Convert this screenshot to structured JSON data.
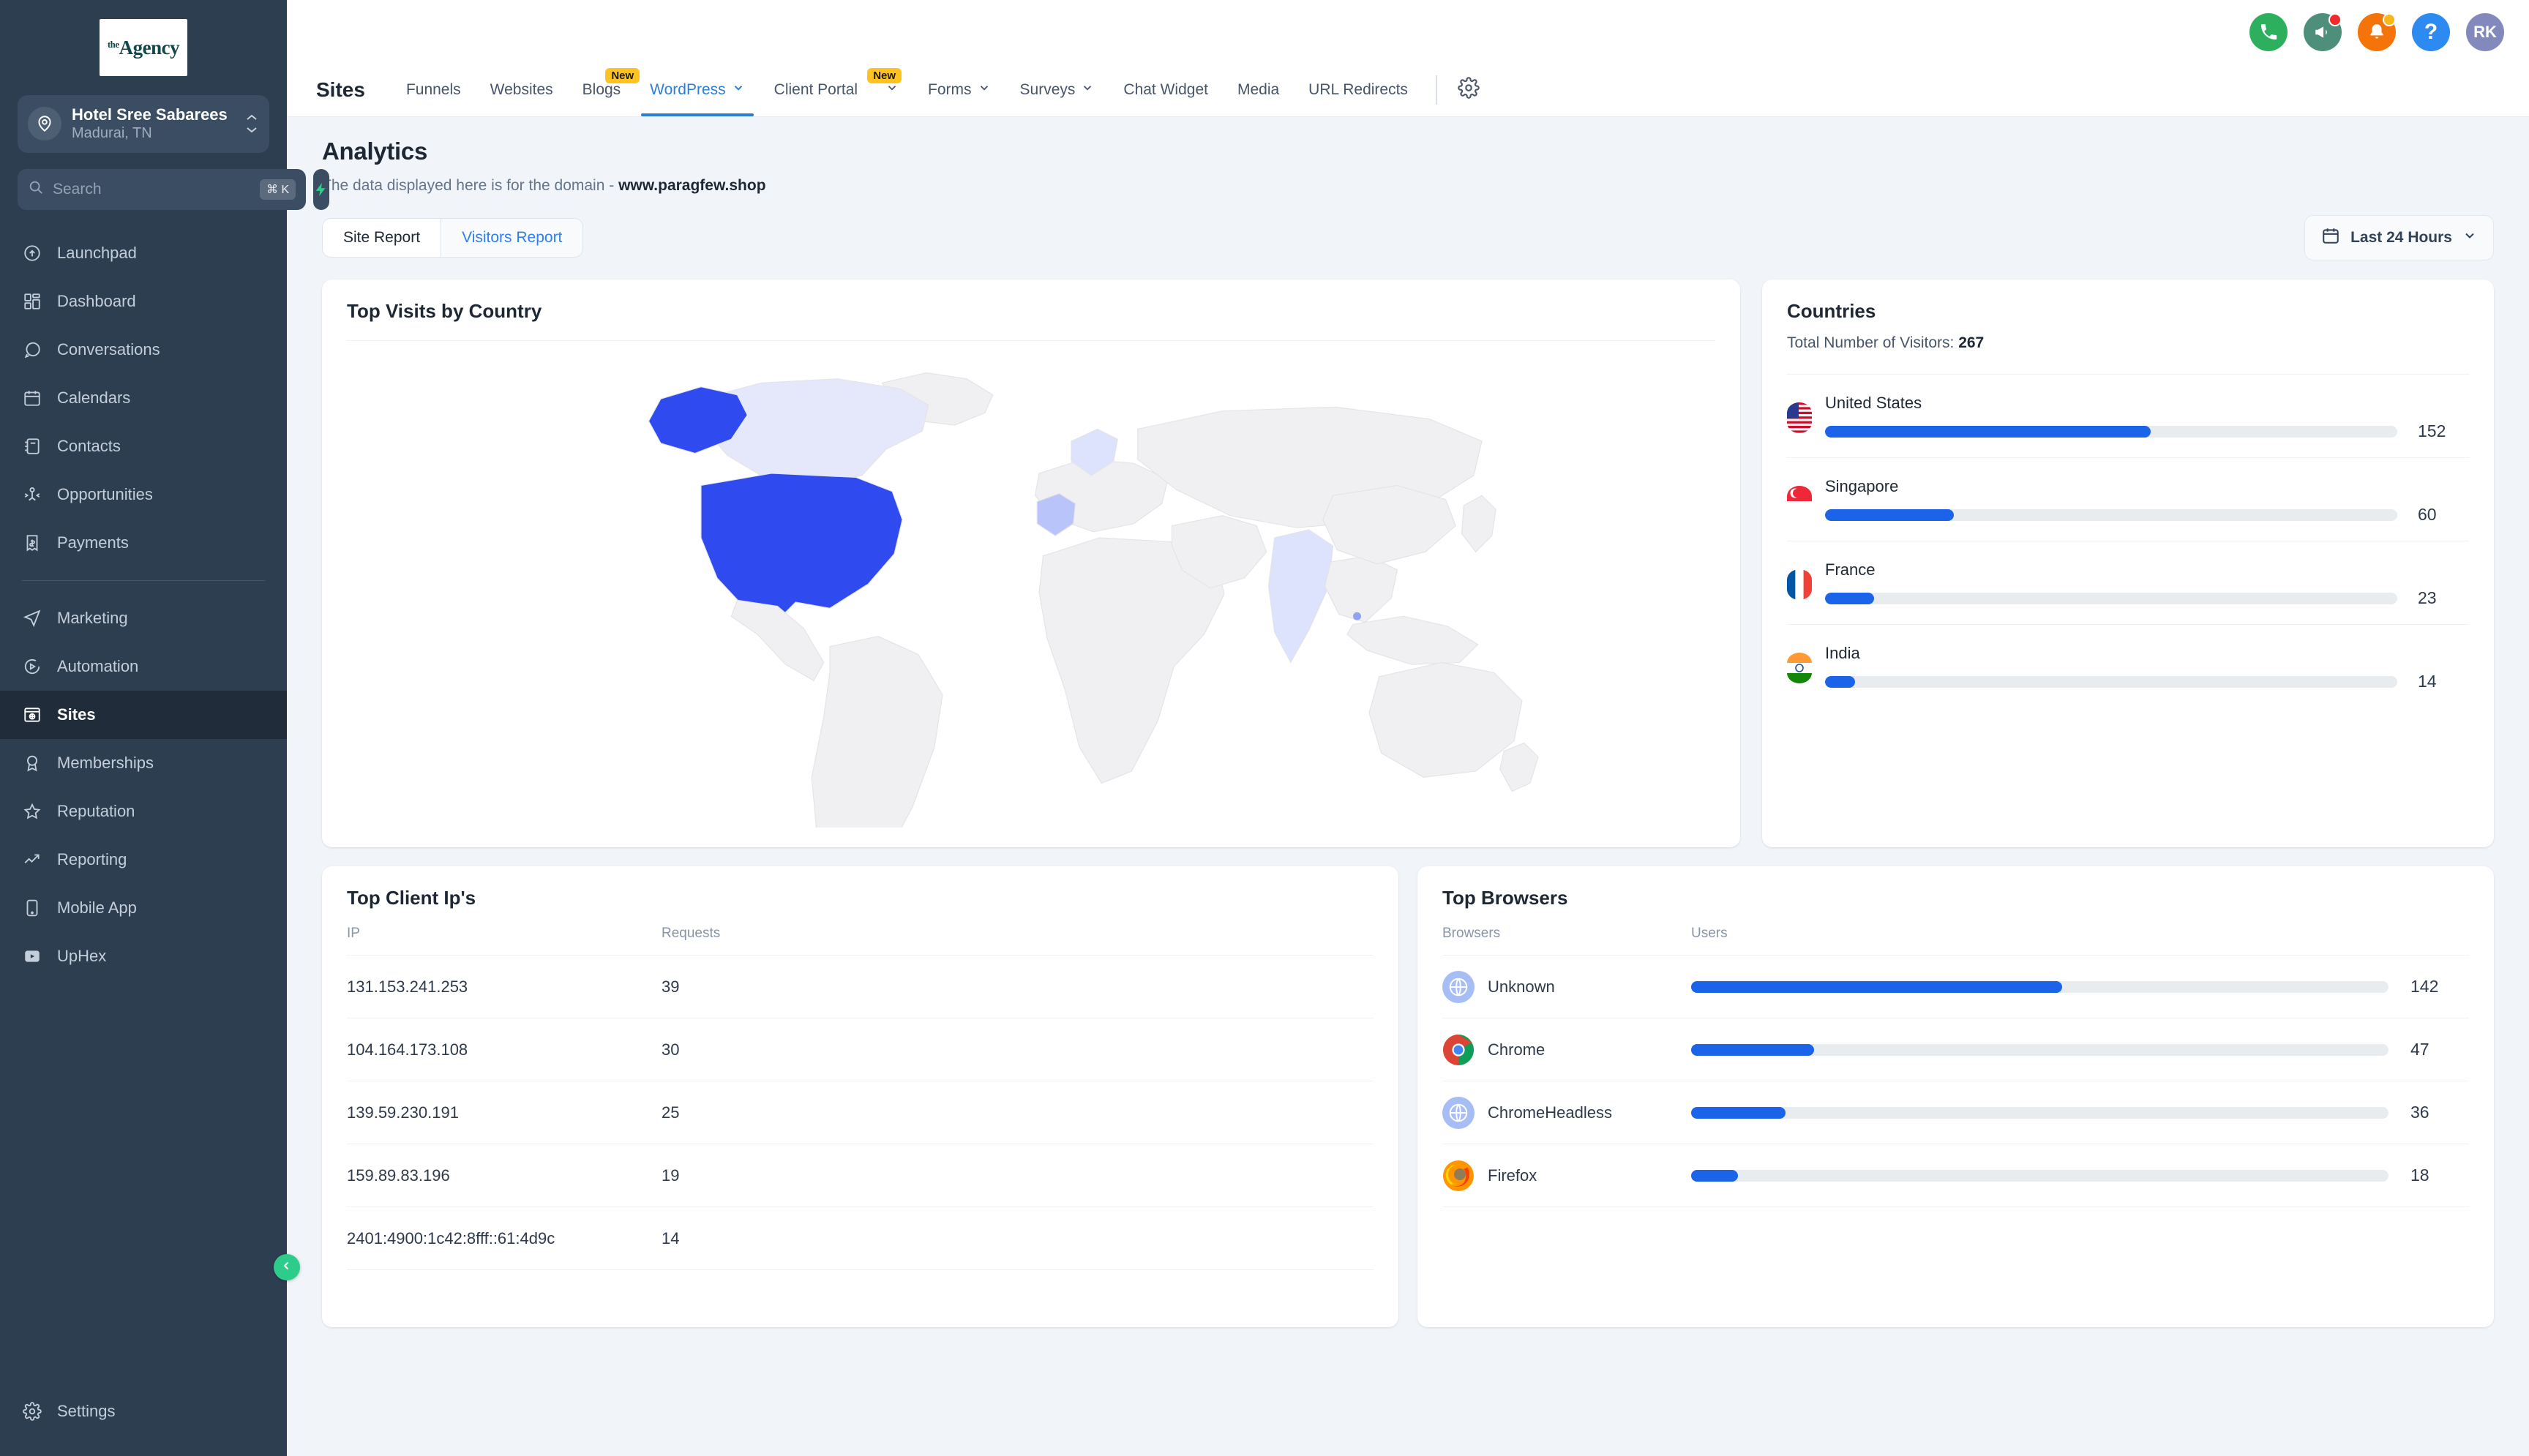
{
  "brand": {
    "logo_text_small": "the",
    "logo_text_main": "Agency"
  },
  "location": {
    "name": "Hotel Sree Sabarees",
    "sub": "Madurai, TN"
  },
  "search": {
    "placeholder": "Search",
    "value": "",
    "shortcut": "⌘ K"
  },
  "sidebar": {
    "items": [
      {
        "label": "Launchpad",
        "icon": "rocket-gauge-icon",
        "active": false
      },
      {
        "label": "Dashboard",
        "icon": "dashboard-grid-icon",
        "active": false
      },
      {
        "label": "Conversations",
        "icon": "chat-bubble-icon",
        "active": false
      },
      {
        "label": "Calendars",
        "icon": "calendar-icon",
        "active": false
      },
      {
        "label": "Contacts",
        "icon": "contacts-book-icon",
        "active": false
      },
      {
        "label": "Opportunities",
        "icon": "opportunities-icon",
        "active": false
      },
      {
        "label": "Payments",
        "icon": "payments-receipt-icon",
        "active": false
      }
    ],
    "items2": [
      {
        "label": "Marketing",
        "icon": "paper-plane-icon",
        "active": false
      },
      {
        "label": "Automation",
        "icon": "play-circle-icon",
        "active": false
      },
      {
        "label": "Sites",
        "icon": "browser-globe-icon",
        "active": true
      },
      {
        "label": "Memberships",
        "icon": "award-badge-icon",
        "active": false
      },
      {
        "label": "Reputation",
        "icon": "star-icon",
        "active": false
      },
      {
        "label": "Reporting",
        "icon": "trend-up-icon",
        "active": false
      },
      {
        "label": "Mobile App",
        "icon": "mobile-phone-icon",
        "active": false
      },
      {
        "label": "UpHex",
        "icon": "video-play-box-icon",
        "active": false
      }
    ],
    "settings_label": "Settings",
    "settings_icon": "gear-icon",
    "collapse_icon": "chevron-left-icon"
  },
  "topbar": {
    "icons": [
      {
        "name": "phone-icon",
        "color": "#2cb05e",
        "badge": null
      },
      {
        "name": "megaphone-icon",
        "color": "#4e8f7c",
        "badge": "#ef2b2b"
      },
      {
        "name": "bell-icon",
        "color": "#f5740a",
        "badge": "#f9b719"
      },
      {
        "name": "help-question-icon",
        "color": "#2d8af0",
        "badge": null
      }
    ],
    "avatar_initials": "RK",
    "avatar_color": "#8289bd"
  },
  "navbar": {
    "title": "Sites",
    "items": [
      {
        "label": "Funnels",
        "caret": false,
        "badge": null,
        "active": false
      },
      {
        "label": "Websites",
        "caret": false,
        "badge": null,
        "active": false
      },
      {
        "label": "Blogs",
        "caret": false,
        "badge": "New",
        "active": false
      },
      {
        "label": "WordPress",
        "caret": true,
        "badge": null,
        "active": true
      },
      {
        "label": "Client Portal",
        "caret": true,
        "badge": "New",
        "active": false
      },
      {
        "label": "Forms",
        "caret": true,
        "badge": null,
        "active": false
      },
      {
        "label": "Surveys",
        "caret": true,
        "badge": null,
        "active": false
      },
      {
        "label": "Chat Widget",
        "caret": false,
        "badge": null,
        "active": false
      },
      {
        "label": "Media",
        "caret": false,
        "badge": null,
        "active": false
      },
      {
        "label": "URL Redirects",
        "caret": false,
        "badge": null,
        "active": false
      }
    ],
    "settings_icon": "gear-icon"
  },
  "page": {
    "title": "Analytics",
    "subtitle_prefix": "The data displayed here is for the domain - ",
    "domain": "www.paragfew.shop",
    "tabs": [
      {
        "label": "Site Report",
        "active": true
      },
      {
        "label": "Visitors Report",
        "active": false
      }
    ],
    "date_range": {
      "label": "Last 24 Hours",
      "icon": "calendar-icon",
      "caret": "chevron-down-icon"
    }
  },
  "map_card": {
    "title": "Top Visits by Country"
  },
  "countries_card": {
    "title": "Countries",
    "total_label": "Total Number of Visitors: ",
    "total_value": "267"
  },
  "client_ips_card": {
    "title": "Top Client Ip's",
    "columns": [
      "IP",
      "Requests"
    ],
    "rows": [
      {
        "ip": "131.153.241.253",
        "requests": "39"
      },
      {
        "ip": "104.164.173.108",
        "requests": "30"
      },
      {
        "ip": "139.59.230.191",
        "requests": "25"
      },
      {
        "ip": "159.89.83.196",
        "requests": "19"
      },
      {
        "ip": "2401:4900:1c42:8fff::61:4d9c",
        "requests": "14"
      }
    ]
  },
  "browsers_card": {
    "title": "Top Browsers",
    "columns": [
      "Browsers",
      "Users"
    ]
  },
  "colors": {
    "accent_blue": "#1b63e8",
    "link_blue": "#2f7ff0",
    "sidebar_bg": "#2e3e51",
    "sidebar_active": "#202c3a",
    "badge_yellow": "#ffc21f",
    "green": "#2ecc8a",
    "track_gray": "#e9ecef"
  },
  "chart_data": [
    {
      "type": "bar",
      "title": "Countries",
      "orientation": "horizontal",
      "xlabel": "",
      "ylabel": "",
      "categories": [
        "United States",
        "Singapore",
        "France",
        "India"
      ],
      "values": [
        152,
        60,
        23,
        14
      ],
      "max": 267,
      "total": 267,
      "flags": [
        "us-flag",
        "sg-flag",
        "fr-flag",
        "in-flag"
      ],
      "legend": "none",
      "grid": false
    },
    {
      "type": "bar",
      "title": "Top Browsers",
      "orientation": "horizontal",
      "xlabel": "Users",
      "ylabel": "Browsers",
      "categories": [
        "Unknown",
        "Chrome",
        "ChromeHeadless",
        "Firefox"
      ],
      "values": [
        142,
        47,
        36,
        18
      ],
      "max": 267,
      "icons": [
        "globe-icon",
        "chrome-icon",
        "globe-icon",
        "firefox-icon"
      ],
      "legend": "none",
      "grid": false
    },
    {
      "type": "table",
      "title": "Top Client Ip's",
      "columns": [
        "IP",
        "Requests"
      ],
      "rows": [
        [
          "131.153.241.253",
          39
        ],
        [
          "104.164.173.108",
          30
        ],
        [
          "139.59.230.191",
          25
        ],
        [
          "159.89.83.196",
          19
        ],
        [
          "2401:4900:1c42:8fff::61:4d9c",
          14
        ]
      ]
    },
    {
      "type": "heatmap",
      "title": "Top Visits by Country",
      "subtype": "choropleth-world-map",
      "regions": [
        {
          "name": "United States",
          "value": 152,
          "shade": "#2f4bf0"
        },
        {
          "name": "Singapore",
          "value": 60,
          "shade": "#8fa3f7"
        },
        {
          "name": "France",
          "value": 23,
          "shade": "#b9c5fa"
        },
        {
          "name": "India",
          "value": 14,
          "shade": "#dde2fd"
        },
        {
          "name": "Canada",
          "value": 0,
          "shade": "#e3e6fb"
        }
      ],
      "base_color": "#f0f0f2",
      "legend": "none"
    }
  ]
}
